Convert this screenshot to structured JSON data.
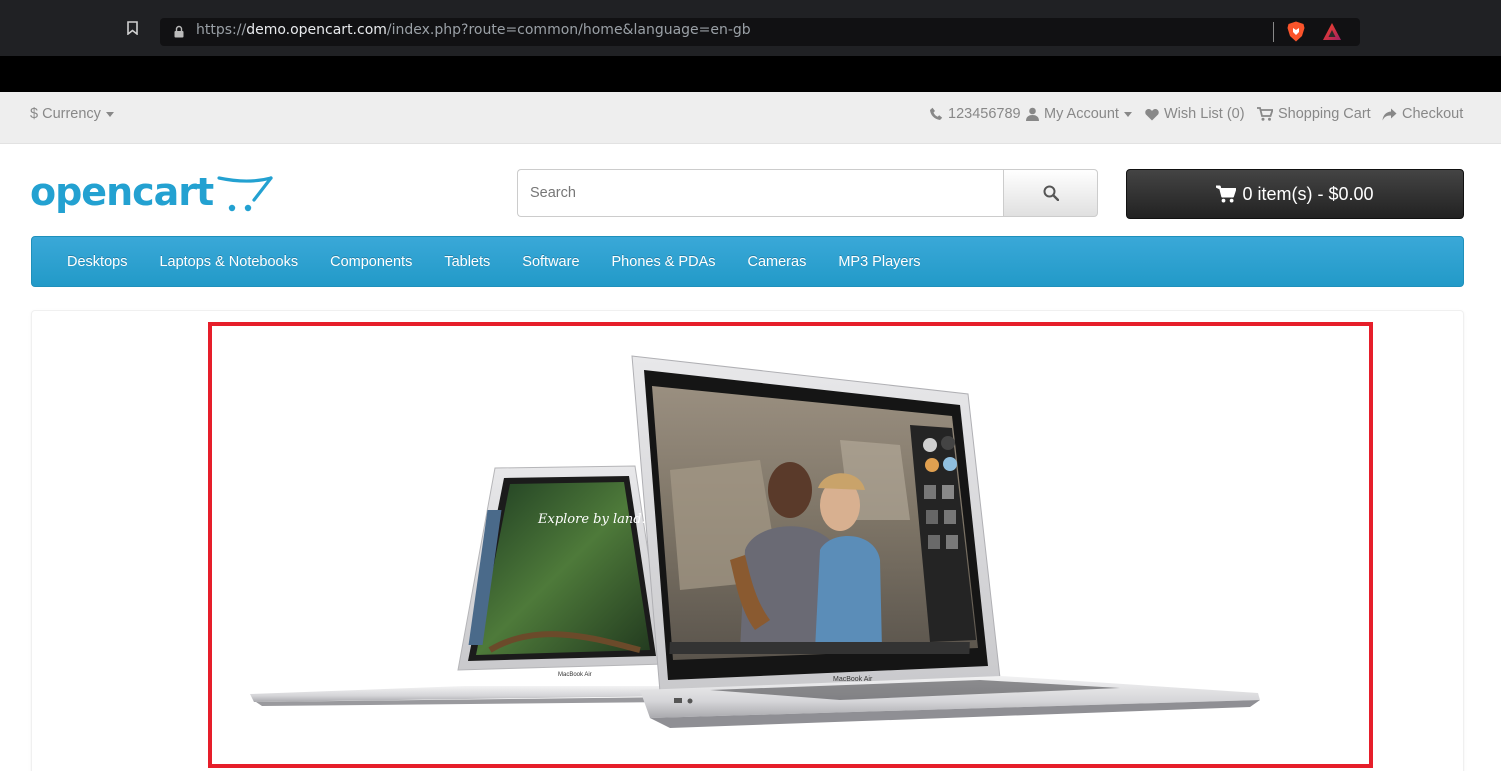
{
  "browser": {
    "url_scheme": "https://",
    "url_host": "demo.opencart.com",
    "url_path": "/index.php?route=common/home&language=en-gb"
  },
  "topbar": {
    "currency_label": "$ Currency",
    "phone": "123456789",
    "my_account": "My Account",
    "wish_list": "Wish List (0)",
    "shopping_cart": "Shopping Cart",
    "checkout": "Checkout"
  },
  "header": {
    "logo_text": "opencart",
    "search_placeholder": "Search",
    "cart_label": "0 item(s) - $0.00"
  },
  "menu": {
    "items": [
      "Desktops",
      "Laptops & Notebooks",
      "Components",
      "Tablets",
      "Software",
      "Phones & PDAs",
      "Cameras",
      "MP3 Players"
    ]
  },
  "banner": {
    "left_screen_text": "Explore by land.",
    "left_brand": "MacBook Air",
    "right_brand": "MacBook Air"
  },
  "colors": {
    "brand_blue": "#23a1d1",
    "highlight_red": "#e61e2a",
    "menu_blue": "#229ac8"
  }
}
